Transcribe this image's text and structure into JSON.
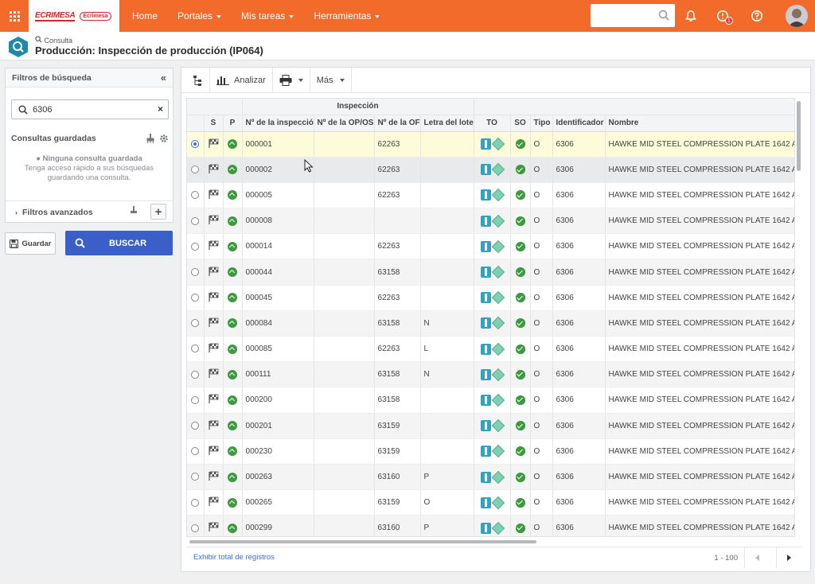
{
  "topbar": {
    "logo_main": "ECRIMESA",
    "logo_secondary": "Ecrimesa",
    "nav": [
      "Home",
      "Portales",
      "Mis tareas",
      "Herramientas"
    ],
    "notification_badge": "1"
  },
  "page": {
    "breadcrumb": "Consulta",
    "title": "Producción: Inspección de producción (IP064)"
  },
  "filters": {
    "title": "Filtros de búsqueda",
    "search_value": "6306",
    "saved_title": "Consultas guardadas",
    "saved_empty_title": "Ninguna consulta guardada",
    "saved_empty_desc_1": "Tenga acceso rápido a sus búsquedas",
    "saved_empty_desc_2": "guardando una consulta.",
    "advanced": "Filtros avanzados",
    "save_label": "Guardar",
    "search_label": "BUSCAR"
  },
  "toolbar": {
    "analyze": "Analizar",
    "more": "Más"
  },
  "grid": {
    "group_header": "Inspección",
    "columns": [
      "S",
      "P",
      "Nº de la inspección",
      "Nº de la OP/OS",
      "Nº de la OF",
      "Letra del lote",
      "TO",
      "SO",
      "Tipo",
      "Identificador",
      "Nombre"
    ],
    "rows": [
      {
        "insp": "000001",
        "op": "",
        "of": "62263",
        "letra": "",
        "tipo": "O",
        "ident": "6306",
        "nombre": "HAWKE MID STEEL COMPRESSION PLATE 1642 A",
        "selected": true
      },
      {
        "insp": "000002",
        "op": "",
        "of": "62263",
        "letra": "",
        "tipo": "O",
        "ident": "6306",
        "nombre": "HAWKE MID STEEL COMPRESSION PLATE 1642 A"
      },
      {
        "insp": "000005",
        "op": "",
        "of": "62263",
        "letra": "",
        "tipo": "O",
        "ident": "6306",
        "nombre": "HAWKE MID STEEL COMPRESSION PLATE 1642 A"
      },
      {
        "insp": "000008",
        "op": "",
        "of": "",
        "letra": "",
        "tipo": "O",
        "ident": "6306",
        "nombre": "HAWKE MID STEEL COMPRESSION PLATE 1642 A"
      },
      {
        "insp": "000014",
        "op": "",
        "of": "62263",
        "letra": "",
        "tipo": "O",
        "ident": "6306",
        "nombre": "HAWKE MID STEEL COMPRESSION PLATE 1642 A"
      },
      {
        "insp": "000044",
        "op": "",
        "of": "63158",
        "letra": "",
        "tipo": "O",
        "ident": "6306",
        "nombre": "HAWKE MID STEEL COMPRESSION PLATE 1642 A"
      },
      {
        "insp": "000045",
        "op": "",
        "of": "62263",
        "letra": "",
        "tipo": "O",
        "ident": "6306",
        "nombre": "HAWKE MID STEEL COMPRESSION PLATE 1642 A"
      },
      {
        "insp": "000084",
        "op": "",
        "of": "63158",
        "letra": "N",
        "tipo": "O",
        "ident": "6306",
        "nombre": "HAWKE MID STEEL COMPRESSION PLATE 1642 A"
      },
      {
        "insp": "000085",
        "op": "",
        "of": "62263",
        "letra": "L",
        "tipo": "O",
        "ident": "6306",
        "nombre": "HAWKE MID STEEL COMPRESSION PLATE 1642 A"
      },
      {
        "insp": "000111",
        "op": "",
        "of": "63158",
        "letra": "N",
        "tipo": "O",
        "ident": "6306",
        "nombre": "HAWKE MID STEEL COMPRESSION PLATE 1642 A"
      },
      {
        "insp": "000200",
        "op": "",
        "of": "63158",
        "letra": "",
        "tipo": "O",
        "ident": "6306",
        "nombre": "HAWKE MID STEEL COMPRESSION PLATE 1642 A"
      },
      {
        "insp": "000201",
        "op": "",
        "of": "63159",
        "letra": "",
        "tipo": "O",
        "ident": "6306",
        "nombre": "HAWKE MID STEEL COMPRESSION PLATE 1642 A"
      },
      {
        "insp": "000230",
        "op": "",
        "of": "63159",
        "letra": "",
        "tipo": "O",
        "ident": "6306",
        "nombre": "HAWKE MID STEEL COMPRESSION PLATE 1642 A"
      },
      {
        "insp": "000263",
        "op": "",
        "of": "63160",
        "letra": "P",
        "tipo": "O",
        "ident": "6306",
        "nombre": "HAWKE MID STEEL COMPRESSION PLATE 1642 A"
      },
      {
        "insp": "000265",
        "op": "",
        "of": "63159",
        "letra": "O",
        "tipo": "O",
        "ident": "6306",
        "nombre": "HAWKE MID STEEL COMPRESSION PLATE 1642 A"
      },
      {
        "insp": "000299",
        "op": "",
        "of": "63160",
        "letra": "P",
        "tipo": "O",
        "ident": "6306",
        "nombre": "HAWKE MID STEEL COMPRESSION PLATE 1642 A"
      }
    ]
  },
  "footer": {
    "show_total": "Exhibir total de registros",
    "range": "1 - 100"
  },
  "colors": {
    "accent": "#f26b2a",
    "primary_button": "#3a5fc9",
    "selected_row": "#fdfbd9",
    "status_green": "#3d9a3f",
    "to_icon": "#2ea3c6"
  }
}
